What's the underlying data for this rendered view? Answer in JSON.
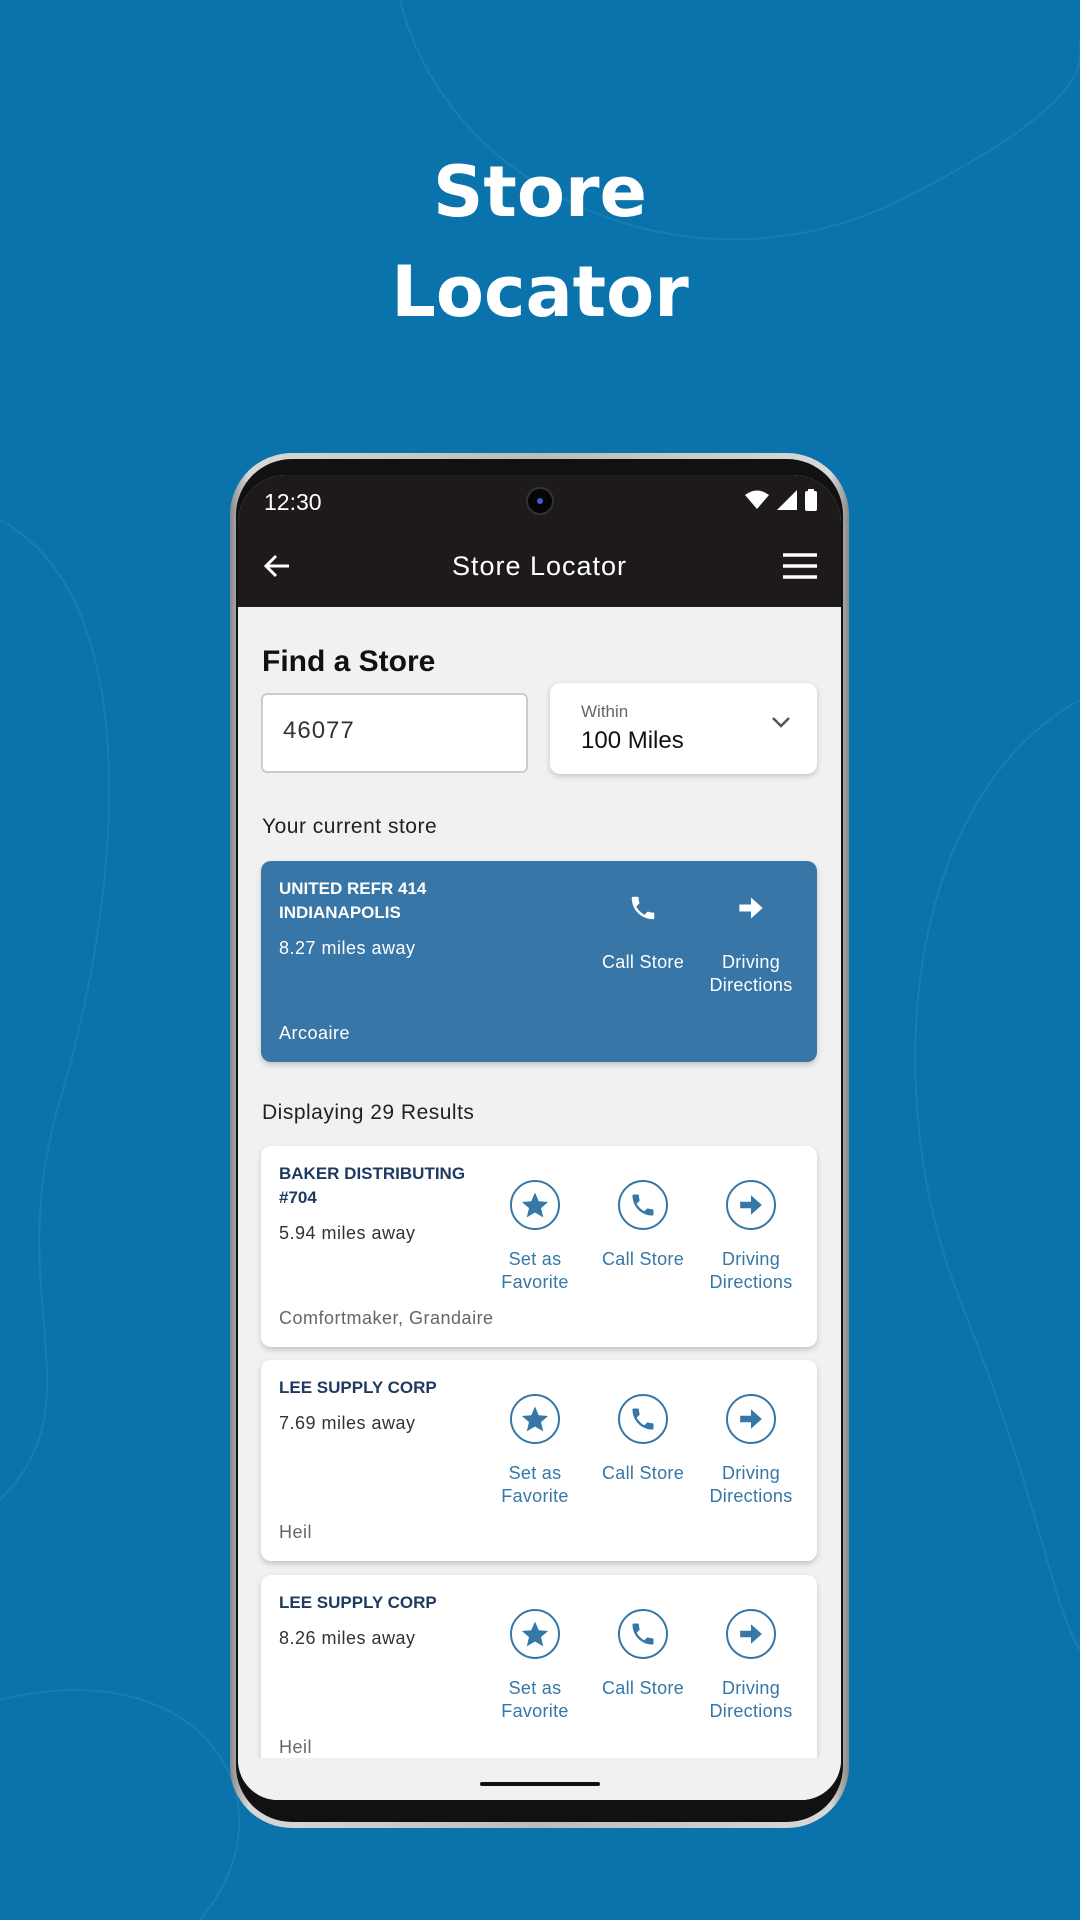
{
  "headline": [
    "Store",
    "Locator"
  ],
  "status": {
    "time": "12:30"
  },
  "appbar": {
    "title": "Store Locator"
  },
  "search": {
    "heading": "Find a Store",
    "zip": "46077",
    "radius_label": "Within",
    "radius_value": "100 Miles"
  },
  "current": {
    "label": "Your current store",
    "name_line1": "UNITED REFR 414",
    "name_line2": "INDIANAPOLIS",
    "distance": "8.27 miles away",
    "brands": "Arcoaire",
    "call": "Call Store",
    "directions_1": "Driving",
    "directions_2": "Directions"
  },
  "results": {
    "count_label": "Displaying 29 Results",
    "actions": {
      "fav_1": "Set as",
      "fav_2": "Favorite",
      "call": "Call Store",
      "dir_1": "Driving",
      "dir_2": "Directions"
    },
    "items": [
      {
        "name_line1": "BAKER DISTRIBUTING",
        "name_line2": "#704",
        "distance": "5.94 miles away",
        "brands": "Comfortmaker, Grandaire"
      },
      {
        "name_line1": "LEE SUPPLY CORP",
        "distance": "7.69 miles away",
        "brands": "Heil"
      },
      {
        "name_line1": "LEE SUPPLY CORP",
        "distance": "8.26 miles away",
        "brands": "Heil"
      }
    ]
  },
  "colors": {
    "background": "#0a73ac",
    "accent": "#3577a6",
    "current_card": "#3776a7",
    "appbar": "#1e1a1a"
  }
}
